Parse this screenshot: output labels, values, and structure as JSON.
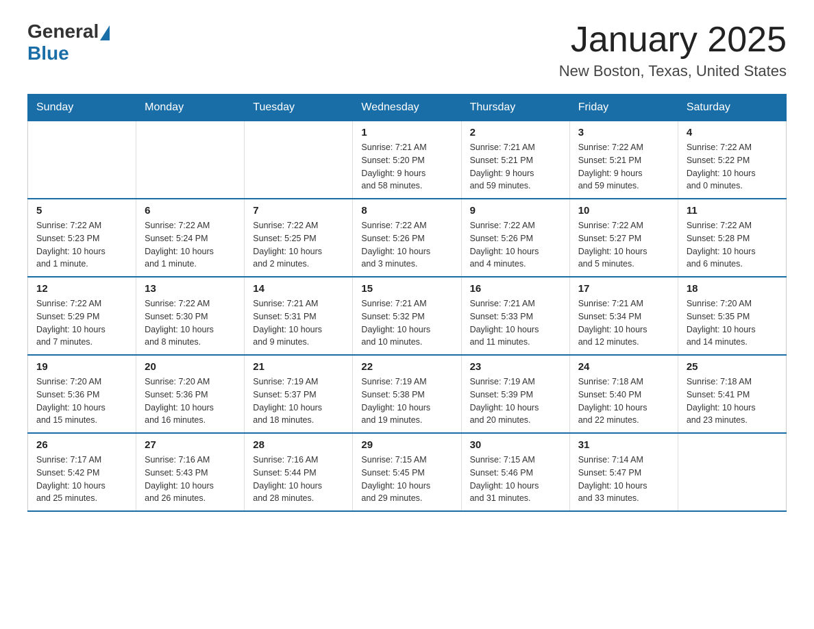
{
  "header": {
    "logo_text_general": "General",
    "logo_text_blue": "Blue",
    "month_title": "January 2025",
    "location": "New Boston, Texas, United States"
  },
  "days_of_week": [
    "Sunday",
    "Monday",
    "Tuesday",
    "Wednesday",
    "Thursday",
    "Friday",
    "Saturday"
  ],
  "weeks": [
    [
      {
        "day": "",
        "info": ""
      },
      {
        "day": "",
        "info": ""
      },
      {
        "day": "",
        "info": ""
      },
      {
        "day": "1",
        "info": "Sunrise: 7:21 AM\nSunset: 5:20 PM\nDaylight: 9 hours\nand 58 minutes."
      },
      {
        "day": "2",
        "info": "Sunrise: 7:21 AM\nSunset: 5:21 PM\nDaylight: 9 hours\nand 59 minutes."
      },
      {
        "day": "3",
        "info": "Sunrise: 7:22 AM\nSunset: 5:21 PM\nDaylight: 9 hours\nand 59 minutes."
      },
      {
        "day": "4",
        "info": "Sunrise: 7:22 AM\nSunset: 5:22 PM\nDaylight: 10 hours\nand 0 minutes."
      }
    ],
    [
      {
        "day": "5",
        "info": "Sunrise: 7:22 AM\nSunset: 5:23 PM\nDaylight: 10 hours\nand 1 minute."
      },
      {
        "day": "6",
        "info": "Sunrise: 7:22 AM\nSunset: 5:24 PM\nDaylight: 10 hours\nand 1 minute."
      },
      {
        "day": "7",
        "info": "Sunrise: 7:22 AM\nSunset: 5:25 PM\nDaylight: 10 hours\nand 2 minutes."
      },
      {
        "day": "8",
        "info": "Sunrise: 7:22 AM\nSunset: 5:26 PM\nDaylight: 10 hours\nand 3 minutes."
      },
      {
        "day": "9",
        "info": "Sunrise: 7:22 AM\nSunset: 5:26 PM\nDaylight: 10 hours\nand 4 minutes."
      },
      {
        "day": "10",
        "info": "Sunrise: 7:22 AM\nSunset: 5:27 PM\nDaylight: 10 hours\nand 5 minutes."
      },
      {
        "day": "11",
        "info": "Sunrise: 7:22 AM\nSunset: 5:28 PM\nDaylight: 10 hours\nand 6 minutes."
      }
    ],
    [
      {
        "day": "12",
        "info": "Sunrise: 7:22 AM\nSunset: 5:29 PM\nDaylight: 10 hours\nand 7 minutes."
      },
      {
        "day": "13",
        "info": "Sunrise: 7:22 AM\nSunset: 5:30 PM\nDaylight: 10 hours\nand 8 minutes."
      },
      {
        "day": "14",
        "info": "Sunrise: 7:21 AM\nSunset: 5:31 PM\nDaylight: 10 hours\nand 9 minutes."
      },
      {
        "day": "15",
        "info": "Sunrise: 7:21 AM\nSunset: 5:32 PM\nDaylight: 10 hours\nand 10 minutes."
      },
      {
        "day": "16",
        "info": "Sunrise: 7:21 AM\nSunset: 5:33 PM\nDaylight: 10 hours\nand 11 minutes."
      },
      {
        "day": "17",
        "info": "Sunrise: 7:21 AM\nSunset: 5:34 PM\nDaylight: 10 hours\nand 12 minutes."
      },
      {
        "day": "18",
        "info": "Sunrise: 7:20 AM\nSunset: 5:35 PM\nDaylight: 10 hours\nand 14 minutes."
      }
    ],
    [
      {
        "day": "19",
        "info": "Sunrise: 7:20 AM\nSunset: 5:36 PM\nDaylight: 10 hours\nand 15 minutes."
      },
      {
        "day": "20",
        "info": "Sunrise: 7:20 AM\nSunset: 5:36 PM\nDaylight: 10 hours\nand 16 minutes."
      },
      {
        "day": "21",
        "info": "Sunrise: 7:19 AM\nSunset: 5:37 PM\nDaylight: 10 hours\nand 18 minutes."
      },
      {
        "day": "22",
        "info": "Sunrise: 7:19 AM\nSunset: 5:38 PM\nDaylight: 10 hours\nand 19 minutes."
      },
      {
        "day": "23",
        "info": "Sunrise: 7:19 AM\nSunset: 5:39 PM\nDaylight: 10 hours\nand 20 minutes."
      },
      {
        "day": "24",
        "info": "Sunrise: 7:18 AM\nSunset: 5:40 PM\nDaylight: 10 hours\nand 22 minutes."
      },
      {
        "day": "25",
        "info": "Sunrise: 7:18 AM\nSunset: 5:41 PM\nDaylight: 10 hours\nand 23 minutes."
      }
    ],
    [
      {
        "day": "26",
        "info": "Sunrise: 7:17 AM\nSunset: 5:42 PM\nDaylight: 10 hours\nand 25 minutes."
      },
      {
        "day": "27",
        "info": "Sunrise: 7:16 AM\nSunset: 5:43 PM\nDaylight: 10 hours\nand 26 minutes."
      },
      {
        "day": "28",
        "info": "Sunrise: 7:16 AM\nSunset: 5:44 PM\nDaylight: 10 hours\nand 28 minutes."
      },
      {
        "day": "29",
        "info": "Sunrise: 7:15 AM\nSunset: 5:45 PM\nDaylight: 10 hours\nand 29 minutes."
      },
      {
        "day": "30",
        "info": "Sunrise: 7:15 AM\nSunset: 5:46 PM\nDaylight: 10 hours\nand 31 minutes."
      },
      {
        "day": "31",
        "info": "Sunrise: 7:14 AM\nSunset: 5:47 PM\nDaylight: 10 hours\nand 33 minutes."
      },
      {
        "day": "",
        "info": ""
      }
    ]
  ]
}
